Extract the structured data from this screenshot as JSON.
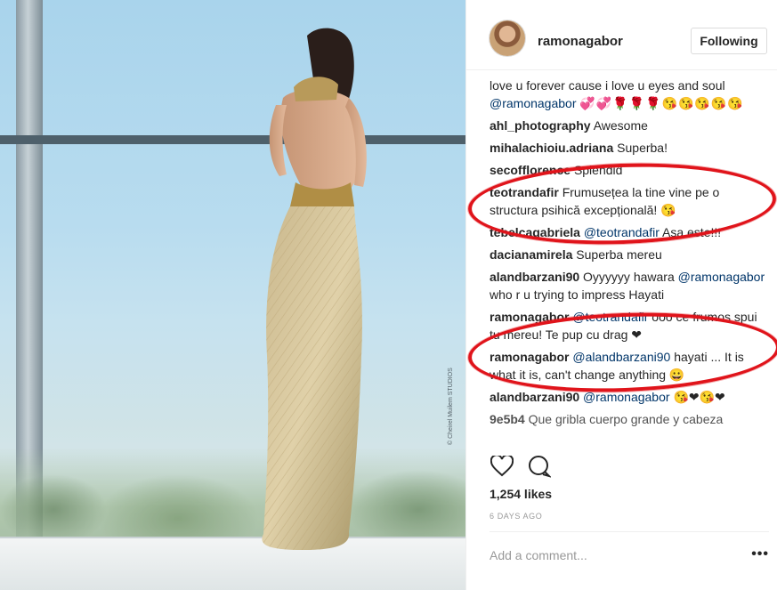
{
  "photo": {
    "credit": "© Cheirel Muilem STUDIOS"
  },
  "header": {
    "username": "ramonagabor",
    "follow_label": "Following"
  },
  "comments": [
    {
      "user": "",
      "text": "love u forever cause i love u eyes and soul ",
      "mention": "@ramonagabor",
      "emoji": "💞💞🌹🌹🌹😘😘😘😘😘"
    },
    {
      "user": "ahl_photography",
      "text": "Awesome"
    },
    {
      "user": "mihalachioiu.adriana",
      "text": "Superba!"
    },
    {
      "user": "secofflorence",
      "text": "Splendid"
    },
    {
      "user": "teotrandafir",
      "text": "Frumusețea la tine vine pe o structura psihică excepțională! 😘"
    },
    {
      "user": "tebelcagabriela",
      "mention": "@teotrandafir",
      "text": "Asa este!!!"
    },
    {
      "user": "dacianamirela",
      "text": "Superba mereu"
    },
    {
      "user": "alandbarzani90",
      "text": "Oyyyyyy hawara ",
      "mention": "@ramonagabor",
      "text2": "who r u trying to impress Hayati"
    },
    {
      "user": "ramonagabor",
      "mention": "@teotrandafir",
      "text": "ooo ce frumos spui tu mereu! Te pup cu drag ❤"
    },
    {
      "user": "ramonagabor",
      "mention": "@alandbarzani90",
      "text": "hayati ... It is what it is, can't change anything 😀"
    },
    {
      "user": "alandbarzani90",
      "mention": "@ramonagabor",
      "text": "😘❤😘❤"
    },
    {
      "user": "9e5b4",
      "text": "Que gribla cuerpo grande y cabeza"
    }
  ],
  "likes": "1,254 likes",
  "time": "6 DAYS AGO",
  "add_comment_placeholder": "Add a comment...",
  "more_label": "•••",
  "icons": {
    "like": "heart-icon",
    "comment": "comment-icon",
    "more": "ellipsis-icon"
  },
  "colors": {
    "highlight": "#e0141b",
    "mention": "#003569"
  }
}
